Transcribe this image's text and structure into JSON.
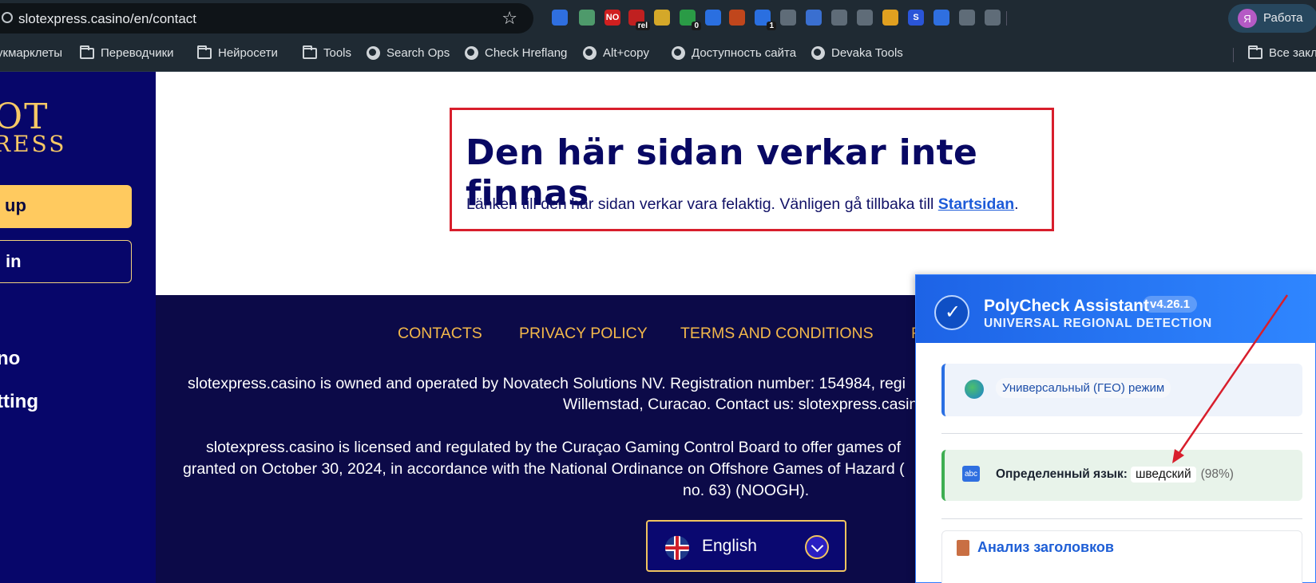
{
  "browser": {
    "url": "slotexpress.casino/en/contact",
    "profile_initial": "Я",
    "profile_label": "Работа",
    "extensions": [
      {
        "name": "extension-icon-1",
        "label": "",
        "bg": "#2f6fe0"
      },
      {
        "name": "extension-icon-2",
        "label": "",
        "bg": "#4e9a6b"
      },
      {
        "name": "noindex-extension-icon",
        "label": "NO",
        "bg": "#d01f1f"
      },
      {
        "name": "rel-extension-icon",
        "label": "",
        "bg": "#c02020",
        "badge": "rel"
      },
      {
        "name": "extension-icon-4",
        "label": "",
        "bg": "#d4a829"
      },
      {
        "name": "extension-icon-5",
        "label": "",
        "bg": "#2a9b46",
        "badge": "0"
      },
      {
        "name": "extension-icon-6",
        "label": "",
        "bg": "#2a6fe0"
      },
      {
        "name": "extension-icon-7",
        "label": "",
        "bg": "#c0461c"
      },
      {
        "name": "extension-icon-8",
        "label": "",
        "bg": "#2a6fe0",
        "badge": "1"
      },
      {
        "name": "mail-icon",
        "label": "",
        "bg": "#5f6c78"
      },
      {
        "name": "undo-icon",
        "label": "",
        "bg": "#3a6fd0"
      },
      {
        "name": "headphones-icon",
        "label": "",
        "bg": "#5f6c78"
      },
      {
        "name": "eyedropper-icon",
        "label": "",
        "bg": "#5f6c78"
      },
      {
        "name": "extension-icon-9",
        "label": "",
        "bg": "#e0a020"
      },
      {
        "name": "extension-icon-s",
        "label": "S",
        "bg": "#2a55d8"
      },
      {
        "name": "extension-icon-10",
        "label": "",
        "bg": "#2f6fe0"
      },
      {
        "name": "puzzle-icon",
        "label": "",
        "bg": "#5f6c78"
      },
      {
        "name": "translate-icon",
        "label": "",
        "bg": "#5f6c78"
      }
    ],
    "bookmarks": [
      {
        "name": "bookmark-bookmarklets",
        "label": "укмарклеты",
        "icon": "none"
      },
      {
        "name": "bookmark-translators",
        "label": "Переводчики",
        "icon": "folder"
      },
      {
        "name": "bookmark-neural",
        "label": "Нейросети",
        "icon": "folder"
      },
      {
        "name": "bookmark-tools",
        "label": "Tools",
        "icon": "folder"
      },
      {
        "name": "bookmark-search-ops",
        "label": "Search Ops",
        "icon": "globe"
      },
      {
        "name": "bookmark-check-hreflang",
        "label": "Check Hreflang",
        "icon": "globe"
      },
      {
        "name": "bookmark-alt-copy",
        "label": "Alt+copy",
        "icon": "globe"
      },
      {
        "name": "bookmark-accessibility",
        "label": "Доступность сайта",
        "icon": "globe"
      },
      {
        "name": "bookmark-devaka",
        "label": "Devaka Tools",
        "icon": "globe"
      },
      {
        "name": "bookmark-all",
        "label": "Все закл",
        "icon": "folder"
      }
    ]
  },
  "site": {
    "logo_line1": "OT",
    "logo_line2": "RESS",
    "signup_label": "up",
    "login_label": "in",
    "side_links": [
      "no",
      "tting"
    ],
    "notfound_title": "Den här sidan verkar inte finnas",
    "notfound_text_before": "Länken till den här sidan verkar vara felaktig. Vänligen gå tillbaka till ",
    "notfound_link": "Startsidan",
    "notfound_text_after": ".",
    "footer_links": [
      "CONTACTS",
      "PRIVACY POLICY",
      "TERMS AND CONDITIONS",
      "F"
    ],
    "footer_p1_l1": "slotexpress.casino is owned and operated by Novatech Solutions NV. Registration number: 154984, regi",
    "footer_p1_l2": "Willemstad, Curacao. Contact us: slotexpress.casin",
    "footer_p2_l1": "slotexpress.casino is licensed and regulated by the Curaçao Gaming Control Board to offer games of",
    "footer_p2_l2": "granted on October 30, 2024, in accordance with the National Ordinance on Offshore Games of Hazard (",
    "footer_p2_l3": "no. 63) (NOOGH).",
    "language_label": "English"
  },
  "extension_panel": {
    "title": "PolyCheck Assistant",
    "version": "v4.26.1",
    "subtitle": "UNIVERSAL REGIONAL DETECTION",
    "geo_mode": "Универсальный (ГЕО) режим",
    "abc_icon": "abc",
    "detected_label": "Определенный язык:",
    "detected_value": "шведский",
    "detected_confidence": "(98%)",
    "headings_title": "Анализ заголовков"
  },
  "colors": {
    "annotation_red": "#d81e2c",
    "site_navy": "#07066a",
    "footer_navy": "#0c0a48",
    "accent_gold": "#f3b84a",
    "panel_blue": "#2a6fe3"
  }
}
